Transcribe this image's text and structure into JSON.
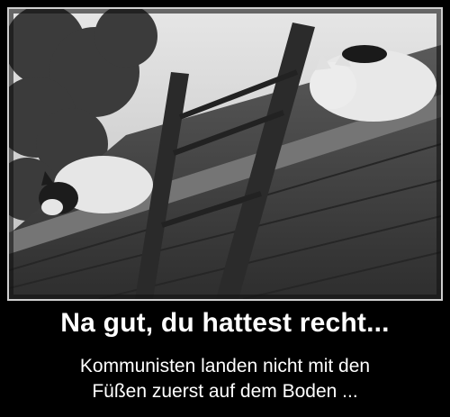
{
  "poster": {
    "title": "Na gut, du hattest recht...",
    "subtitle_line1": "Kommunisten landen nicht mit den",
    "subtitle_line2": "Füßen zuerst auf dem Boden ..."
  },
  "photo": {
    "subjects": [
      "cat",
      "cat",
      "ladder",
      "roof ledge"
    ],
    "palette": {
      "sky": "#d9d9d9",
      "wall": "#4a4a4a",
      "ledge": "#6a6a6a",
      "cat_white": "#e8e8e8",
      "cat_dark": "#1a1a1a"
    }
  }
}
